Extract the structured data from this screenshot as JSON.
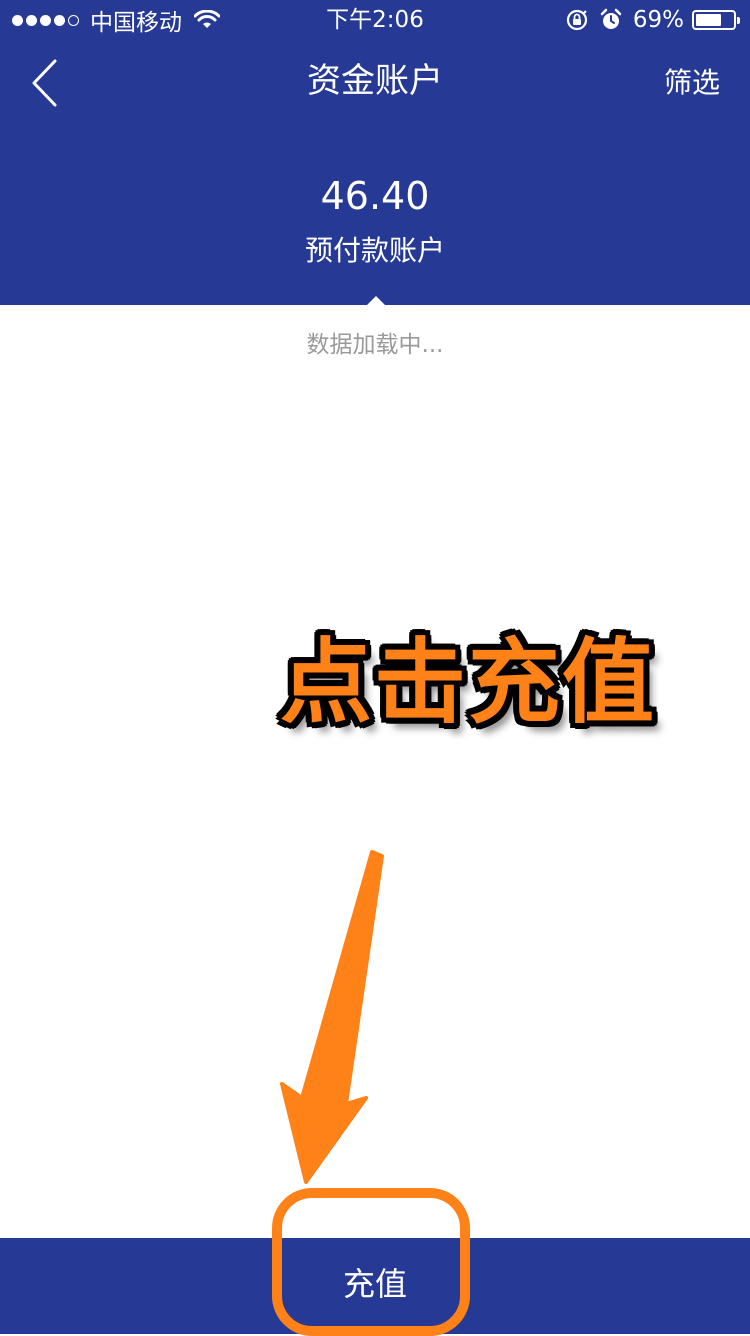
{
  "status_bar": {
    "carrier": "中国移动",
    "time": "下午2:06",
    "battery_percent": "69%",
    "battery_level": 0.69,
    "signal_bars_filled": 4,
    "signal_bars_total": 5,
    "icons": [
      "wifi-icon",
      "orientation-lock-icon",
      "alarm-icon",
      "battery-icon"
    ]
  },
  "nav": {
    "title": "资金账户",
    "back_icon": "chevron-left-icon",
    "filter_label": "筛选"
  },
  "account": {
    "balance": "46.40",
    "label": "预付款账户"
  },
  "content": {
    "loading_text": "数据加载中..."
  },
  "annotation": {
    "text": "点击充值",
    "color": "#ff8219"
  },
  "bottom_bar": {
    "recharge_label": "充值"
  },
  "colors": {
    "primary": "#263a95",
    "background": "#ffffff",
    "loading_text": "#9a9a9a",
    "annotation": "#ff8219"
  }
}
